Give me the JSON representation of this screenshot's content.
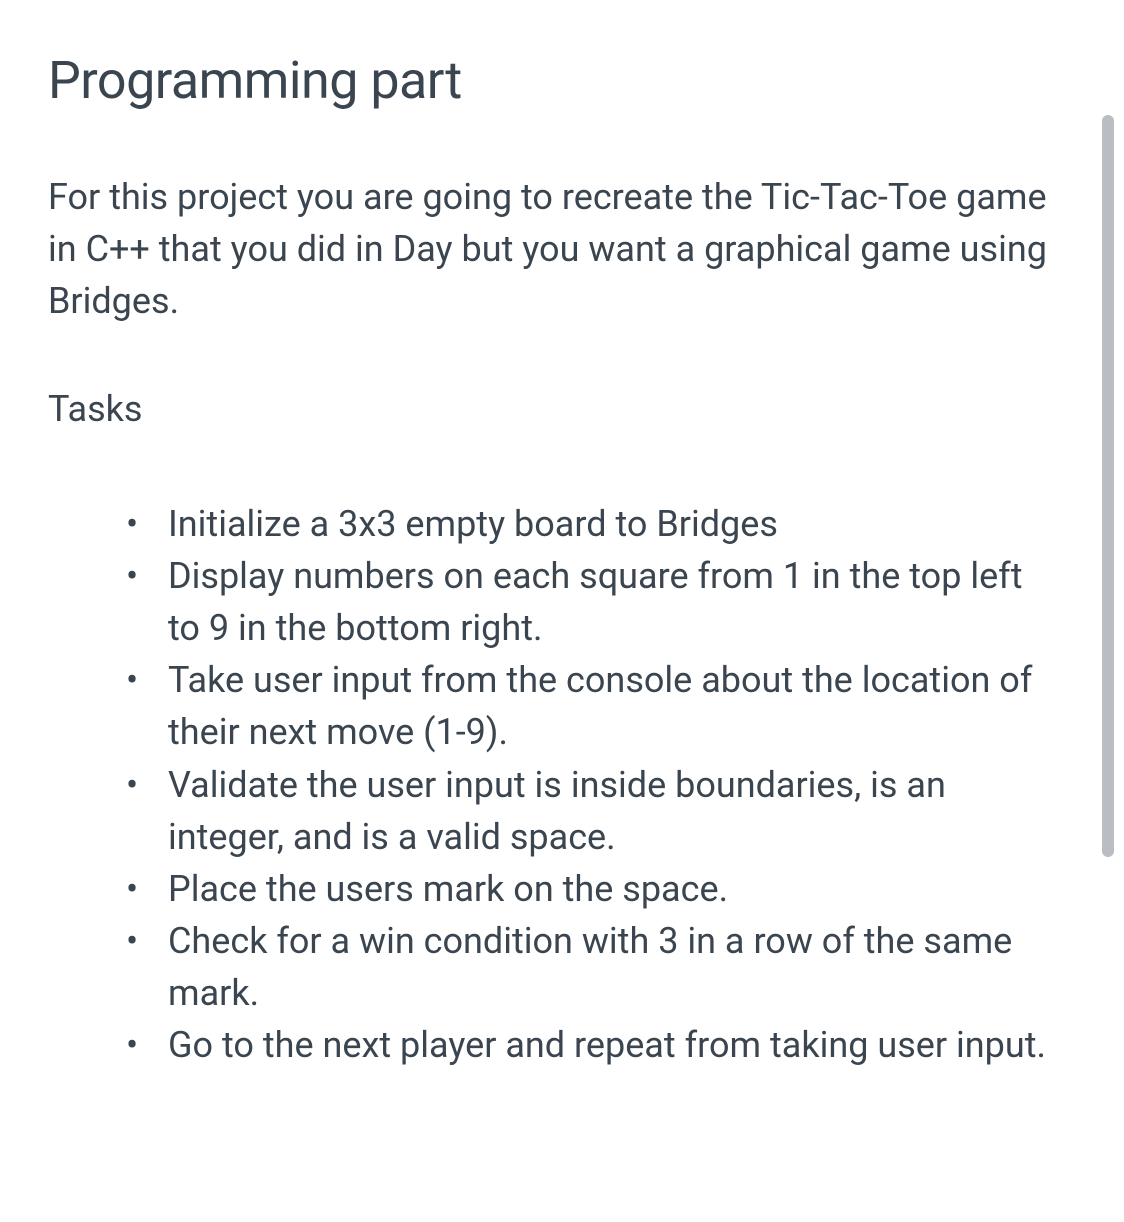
{
  "heading": "Programming part",
  "intro": "For this project you are going to recreate the Tic-Tac-Toe game in C++ that you did in Day but you want a graphical game using Bridges.",
  "tasks_label": "Tasks",
  "tasks": [
    "Initialize a 3x3 empty board to Bridges",
    "Display numbers on each square from 1 in the top left to 9 in the bottom right.",
    "Take user input from the console about the location of their next move (1-9).",
    "Validate the user input is inside boundaries, is an integer, and is a valid space.",
    "Place the users mark on the space.",
    "Check for a win condition with 3 in a row of the same mark.",
    "Go to the next player and repeat from taking user input."
  ]
}
